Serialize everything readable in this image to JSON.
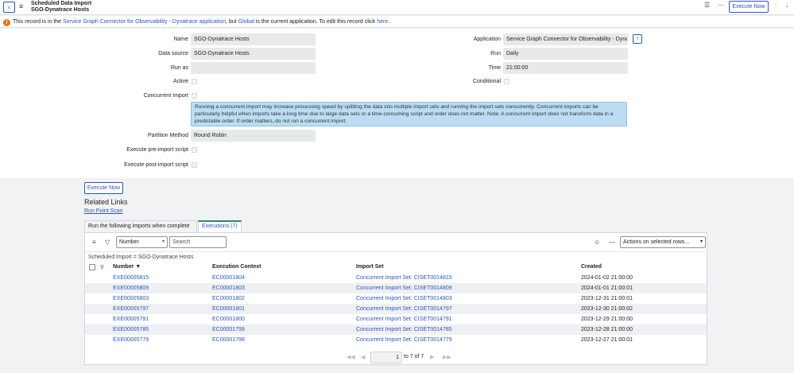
{
  "header": {
    "title_line1": "Scheduled Data Import",
    "title_line2": "SGO-Dynatrace Hosts",
    "back_icon": "chevron-left-icon",
    "menu_icon": "hamburger-icon",
    "execute_now_label": "Execute Now"
  },
  "notice": {
    "prefix": "This record is in the",
    "app_link": "Service Graph Connector for Observability - Dynatrace application",
    "middle": ", but",
    "global_link": "Global",
    "suffix": "is the current application. To edit this record click",
    "here_link": "here",
    "end": "."
  },
  "form": {
    "name_label": "Name",
    "name_value": "SGO-Dynatrace Hosts",
    "datasource_label": "Data source",
    "datasource_value": "SGO-Dynatrace Hosts",
    "runas_label": "Run as",
    "runas_value": "",
    "active_label": "Active",
    "concurrent_label": "Concurrent Import",
    "concurrent_info": "Running a concurrent import may increase processing speed by splitting the data into multiple import sets and running the import sets concurrently. Concurrent imports can be particularly helpful when imports take a long time due to large data sets or a time-consuming script and order does not matter. Note: A concurrent import does not transform data in a predictable order. If order matters, do not run a concurrent import.",
    "partition_label": "Partition Method",
    "partition_value": "Round Robin",
    "pre_script_label": "Execute pre-import script",
    "post_script_label": "Execute post-import script",
    "application_label": "Application",
    "application_value": "Service Graph Connector for Observability - Dynatrace",
    "run_label": "Run",
    "run_value": "Daily",
    "time_label": "Time",
    "time_value": "21:00:00",
    "conditional_label": "Conditional"
  },
  "execute_now_bottom": "Execute Now",
  "related_links": {
    "title": "Related Links",
    "link": "Run Point Scan"
  },
  "tabs": [
    {
      "label": "Run the following imports when complete (..."
    },
    {
      "label": "Executions (7)"
    }
  ],
  "list": {
    "filter_field": "Number",
    "search_placeholder": "Search",
    "actions_label": "Actions on selected rows...",
    "breadcrumb": "Scheduled Import = SGO-Dynatrace Hosts",
    "columns": [
      "Number",
      "Execution Context",
      "Import Set",
      "Created"
    ],
    "sort_indicator": "▼",
    "rows": [
      {
        "number": "EXE00005815",
        "context": "EC00001804",
        "import_set": "Concurrent Import Set: CISET0014815",
        "created": "2024-01-02 21:00:00"
      },
      {
        "number": "EXE00005809",
        "context": "EC00001803",
        "import_set": "Concurrent Import Set: CISET0014809",
        "created": "2024-01-01 21:00:01"
      },
      {
        "number": "EXE00005803",
        "context": "EC00001802",
        "import_set": "Concurrent Import Set: CISET0014803",
        "created": "2023-12-31 21:00:01"
      },
      {
        "number": "EXE00005797",
        "context": "EC00001801",
        "import_set": "Concurrent Import Set: CISET0014797",
        "created": "2023-12-30 21:00:02"
      },
      {
        "number": "EXE00005791",
        "context": "EC00001800",
        "import_set": "Concurrent Import Set: CISET0014791",
        "created": "2023-12-29 21:00:00"
      },
      {
        "number": "EXE00005785",
        "context": "EC00001799",
        "import_set": "Concurrent Import Set: CISET0014785",
        "created": "2023-12-28 21:00:00"
      },
      {
        "number": "EXE00005779",
        "context": "EC00001798",
        "import_set": "Concurrent Import Set: CISET0014779",
        "created": "2023-12-27 21:00:01"
      }
    ],
    "pager": {
      "current": "1",
      "of_text": "to 7 of 7"
    }
  }
}
